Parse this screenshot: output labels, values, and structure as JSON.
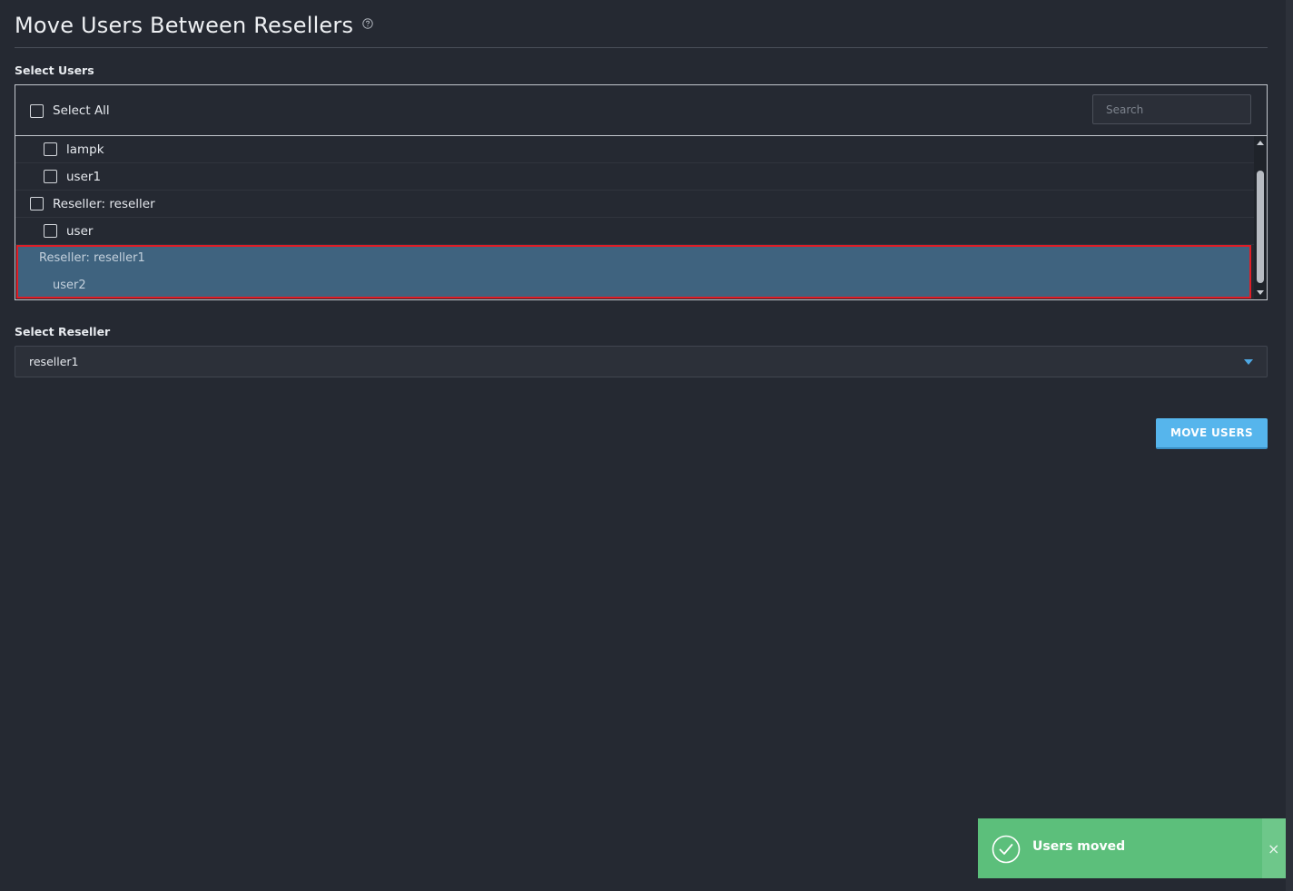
{
  "page": {
    "title": "Move Users Between Resellers"
  },
  "users_section": {
    "label": "Select Users",
    "select_all_label": "Select All",
    "search_placeholder": "Search",
    "rows": [
      {
        "label": "lampk",
        "type": "user"
      },
      {
        "label": "user1",
        "type": "user"
      },
      {
        "label": "Reseller: reseller",
        "type": "reseller"
      },
      {
        "label": "user",
        "type": "user"
      }
    ],
    "disabled_group": {
      "reseller_label": "Reseller: reseller1",
      "user_label": "user2"
    }
  },
  "reseller_section": {
    "label": "Select Reseller",
    "selected_value": "reseller1"
  },
  "actions": {
    "move_label": "MOVE USERS"
  },
  "toast": {
    "message": "Users moved",
    "close_symbol": "×"
  },
  "icons": {
    "help": "question-circle-icon",
    "toast": "check-circle-icon",
    "caret": "chevron-down-icon"
  },
  "colors": {
    "background": "#252932",
    "accent": "#56b5ec",
    "selected_group": "#3f637f",
    "highlight_border": "#e01d26",
    "success": "#5cbf7b"
  }
}
